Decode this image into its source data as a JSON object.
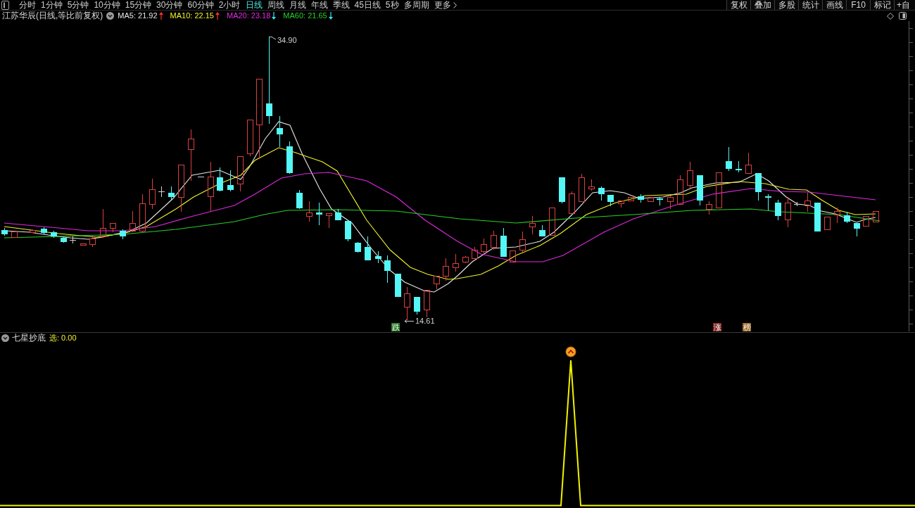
{
  "toolbar": {
    "tabs": [
      {
        "label": "分时",
        "selected": false
      },
      {
        "label": "1分钟",
        "selected": false
      },
      {
        "label": "5分钟",
        "selected": false
      },
      {
        "label": "10分钟",
        "selected": false
      },
      {
        "label": "15分钟",
        "selected": false
      },
      {
        "label": "30分钟",
        "selected": false
      },
      {
        "label": "60分钟",
        "selected": false
      },
      {
        "label": "2小时",
        "selected": false
      },
      {
        "label": "日线",
        "selected": true
      },
      {
        "label": "周线",
        "selected": false
      },
      {
        "label": "月线",
        "selected": false
      },
      {
        "label": "年线",
        "selected": false
      },
      {
        "label": "季线",
        "selected": false
      },
      {
        "label": "45日线",
        "selected": false
      },
      {
        "label": "5秒",
        "selected": false
      },
      {
        "label": "多周期",
        "selected": false
      }
    ],
    "more": "更多",
    "buttons": [
      "复权",
      "叠加",
      "多股",
      "统计",
      "画线",
      "F10",
      "标记",
      "+自"
    ]
  },
  "chart_header": {
    "title": "江苏华辰(日线,等比前复权)",
    "indicators": [
      {
        "label": "MA5: 21.92",
        "color": "#e6e6e6",
        "rising": true
      },
      {
        "label": "MA10: 22.15",
        "color": "#f2f22a",
        "rising": true
      },
      {
        "label": "MA20: 23.18",
        "color": "#e028e0",
        "rising": false
      },
      {
        "label": "MA60: 21.65",
        "color": "#28d028",
        "rising": false
      }
    ]
  },
  "main_chart": {
    "high_label": "34.90",
    "low_label": "14.61",
    "markers": [
      {
        "text": "跌",
        "color": "#2a7a2a"
      },
      {
        "text": "涨",
        "color": "#8a2424"
      },
      {
        "text": "榜",
        "color": "#9a6a24"
      }
    ]
  },
  "indicator_panel": {
    "name": "七星抄底",
    "value": "选: 0.00"
  }
}
